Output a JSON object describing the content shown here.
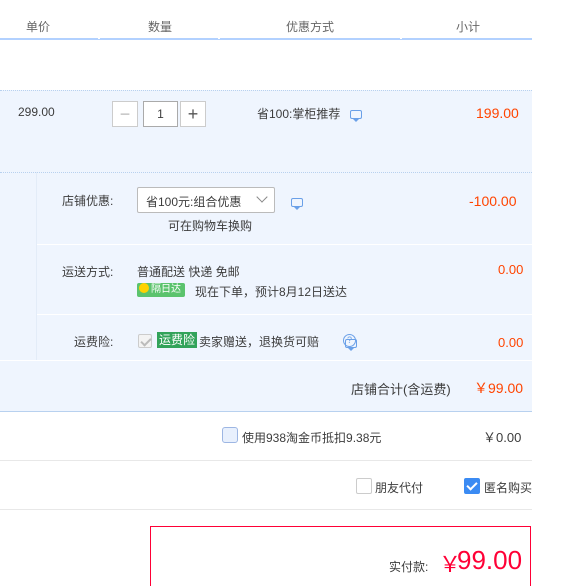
{
  "header": {
    "col_price": "单价",
    "col_qty": "数量",
    "col_discount": "优惠方式",
    "col_subtotal": "小计"
  },
  "item": {
    "price": "299.00",
    "quantity": "1",
    "minus": "−",
    "plus": "+",
    "promo": "省100:掌柜推荐",
    "subtotal": "199.00"
  },
  "shop": {
    "discount_label": "店铺优惠:",
    "discount_select": "省100元:组合优惠",
    "discount_hint": "可在购物车换购",
    "discount_value": "-100.00",
    "shipping_label": "运送方式:",
    "shipping_method": "普通配送 快递 免邮",
    "shipping_badge": "隔日达",
    "shipping_eta": "现在下单，预计8月12日送达",
    "shipping_value": "0.00",
    "insurance_label": "运费险:",
    "insurance_badge": "运费险",
    "insurance_desc": "卖家赠送，退换货可赔",
    "insurance_value": "0.00",
    "total_label": "店铺合计(含运费)",
    "total_value": "￥99.00"
  },
  "coins": {
    "label": "使用938淘金币抵扣9.38元",
    "value": "￥0.00"
  },
  "options": {
    "friend_pay": "朋友代付",
    "anonymous": "匿名购买",
    "anonymous_checked": true
  },
  "payment": {
    "label": "实付款:",
    "currency": "￥",
    "amount": "99.00"
  },
  "colors": {
    "accent": "#3b8bf3",
    "price_red": "#ff4400",
    "pay_red": "#ff0036",
    "row_bg": "#eff5fe"
  }
}
